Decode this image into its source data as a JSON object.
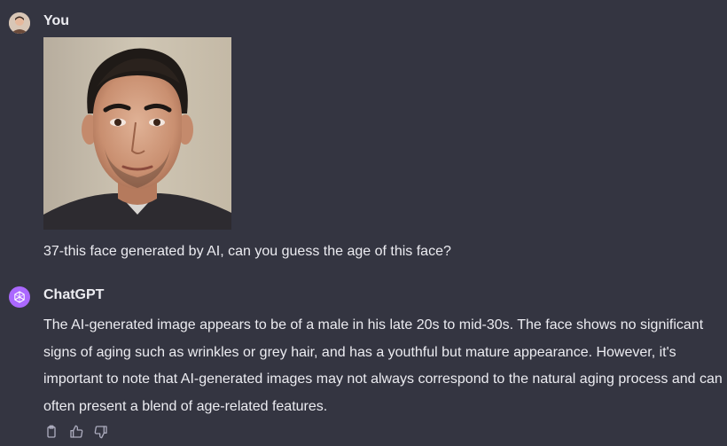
{
  "conversation": {
    "user": {
      "author": "You",
      "avatar_icon": "user-avatar-photo",
      "attachment": {
        "type": "image",
        "icon": "portrait-photo"
      },
      "text": "37-this face generated by AI, can you guess the age of this face?"
    },
    "assistant": {
      "author": "ChatGPT",
      "avatar_icon": "openai-logo-icon",
      "avatar_color": "#ab68ff",
      "text": "The AI-generated image appears to be of a male in his late 20s to mid-30s. The face shows no significant signs of aging such as wrinkles or grey hair, and has a youthful but mature appearance. However, it's important to note that AI-generated images may not always correspond to the natural aging process and can often present a blend of age-related features.",
      "actions": [
        {
          "name": "copy-button",
          "icon": "clipboard-icon"
        },
        {
          "name": "thumbs-up-button",
          "icon": "thumbs-up-icon"
        },
        {
          "name": "thumbs-down-button",
          "icon": "thumbs-down-icon"
        }
      ]
    }
  },
  "theme": {
    "background": "#343541",
    "text": "#ececf1",
    "icon": "#acacbe"
  }
}
